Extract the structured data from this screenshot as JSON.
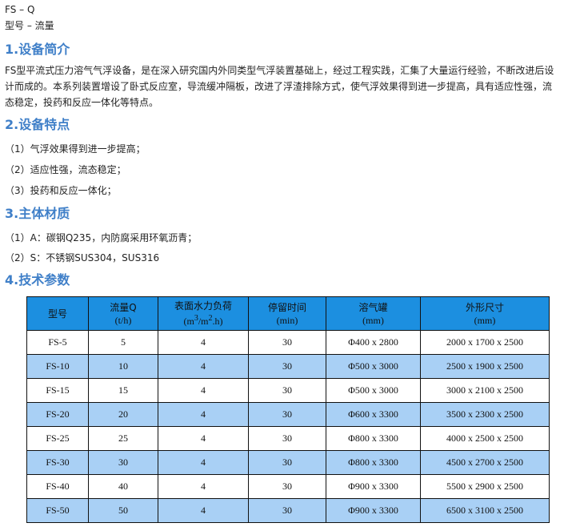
{
  "header": {
    "model_code": "FS – Q",
    "model_legend": "型号 – 流量"
  },
  "sections": [
    {
      "title": "1.设备简介"
    },
    {
      "title": "2.设备特点"
    },
    {
      "title": "3.主体材质"
    },
    {
      "title": "4.技术参数"
    }
  ],
  "intro": {
    "text": "FS型平流式压力溶气气浮设备，是在深入研究国内外同类型气浮装置基础上，经过工程实践，汇集了大量运行经验，不断改进后设计而成的。本系列装置增设了卧式反应室，导流缓冲隔板，改进了浮渣排除方式，使气浮效果得到进一步提高，具有适应性强，流态稳定，投药和反应一体化等特点。"
  },
  "features": [
    "（1）气浮效果得到进一步提高；",
    "（2）适应性强，流态稳定；",
    "（3）投药和反应一体化；"
  ],
  "materials": [
    "（1）A：碳钢Q235，内防腐采用环氧沥青；",
    "（2）S：不锈钢SUS304，SUS316"
  ],
  "table": {
    "headers": [
      {
        "label": "型号",
        "unit": ""
      },
      {
        "label": "流量Q",
        "unit": "(t/h)"
      },
      {
        "label": "表面水力负荷",
        "unit": "(m3/m2.h)"
      },
      {
        "label": "停留时间",
        "unit": "(min)"
      },
      {
        "label": "溶气罐",
        "unit": "(mm)"
      },
      {
        "label": "外形尺寸",
        "unit": "(mm)"
      }
    ],
    "rows": [
      [
        "FS-5",
        "5",
        "4",
        "30",
        "Φ400 x 2800",
        "2000 x 1700 x 2500"
      ],
      [
        "FS-10",
        "10",
        "4",
        "30",
        "Φ500 x 3000",
        "2500 x 1900 x 2500"
      ],
      [
        "FS-15",
        "15",
        "4",
        "30",
        "Φ500 x 3000",
        "3000 x 2100 x 2500"
      ],
      [
        "FS-20",
        "20",
        "4",
        "30",
        "Φ600 x 3300",
        "3500 x 2300 x 2500"
      ],
      [
        "FS-25",
        "25",
        "4",
        "30",
        "Φ800 x 3300",
        "4000 x 2500 x 2500"
      ],
      [
        "FS-30",
        "30",
        "4",
        "30",
        "Φ800 x 3300",
        "4500 x 2700 x 2500"
      ],
      [
        "FS-40",
        "40",
        "4",
        "30",
        "Φ900 x 3300",
        "5500 x 2900 x 2500"
      ],
      [
        "FS-50",
        "50",
        "4",
        "30",
        "Φ900 x 3300",
        "6500 x 3100 x 2500"
      ]
    ],
    "colors": {
      "header_bg": "#1c8fe0",
      "even_row_bg": "#a9d0f5",
      "odd_row_bg": "#ffffff"
    }
  },
  "colors": {
    "section_title": "#3f7fc8"
  }
}
